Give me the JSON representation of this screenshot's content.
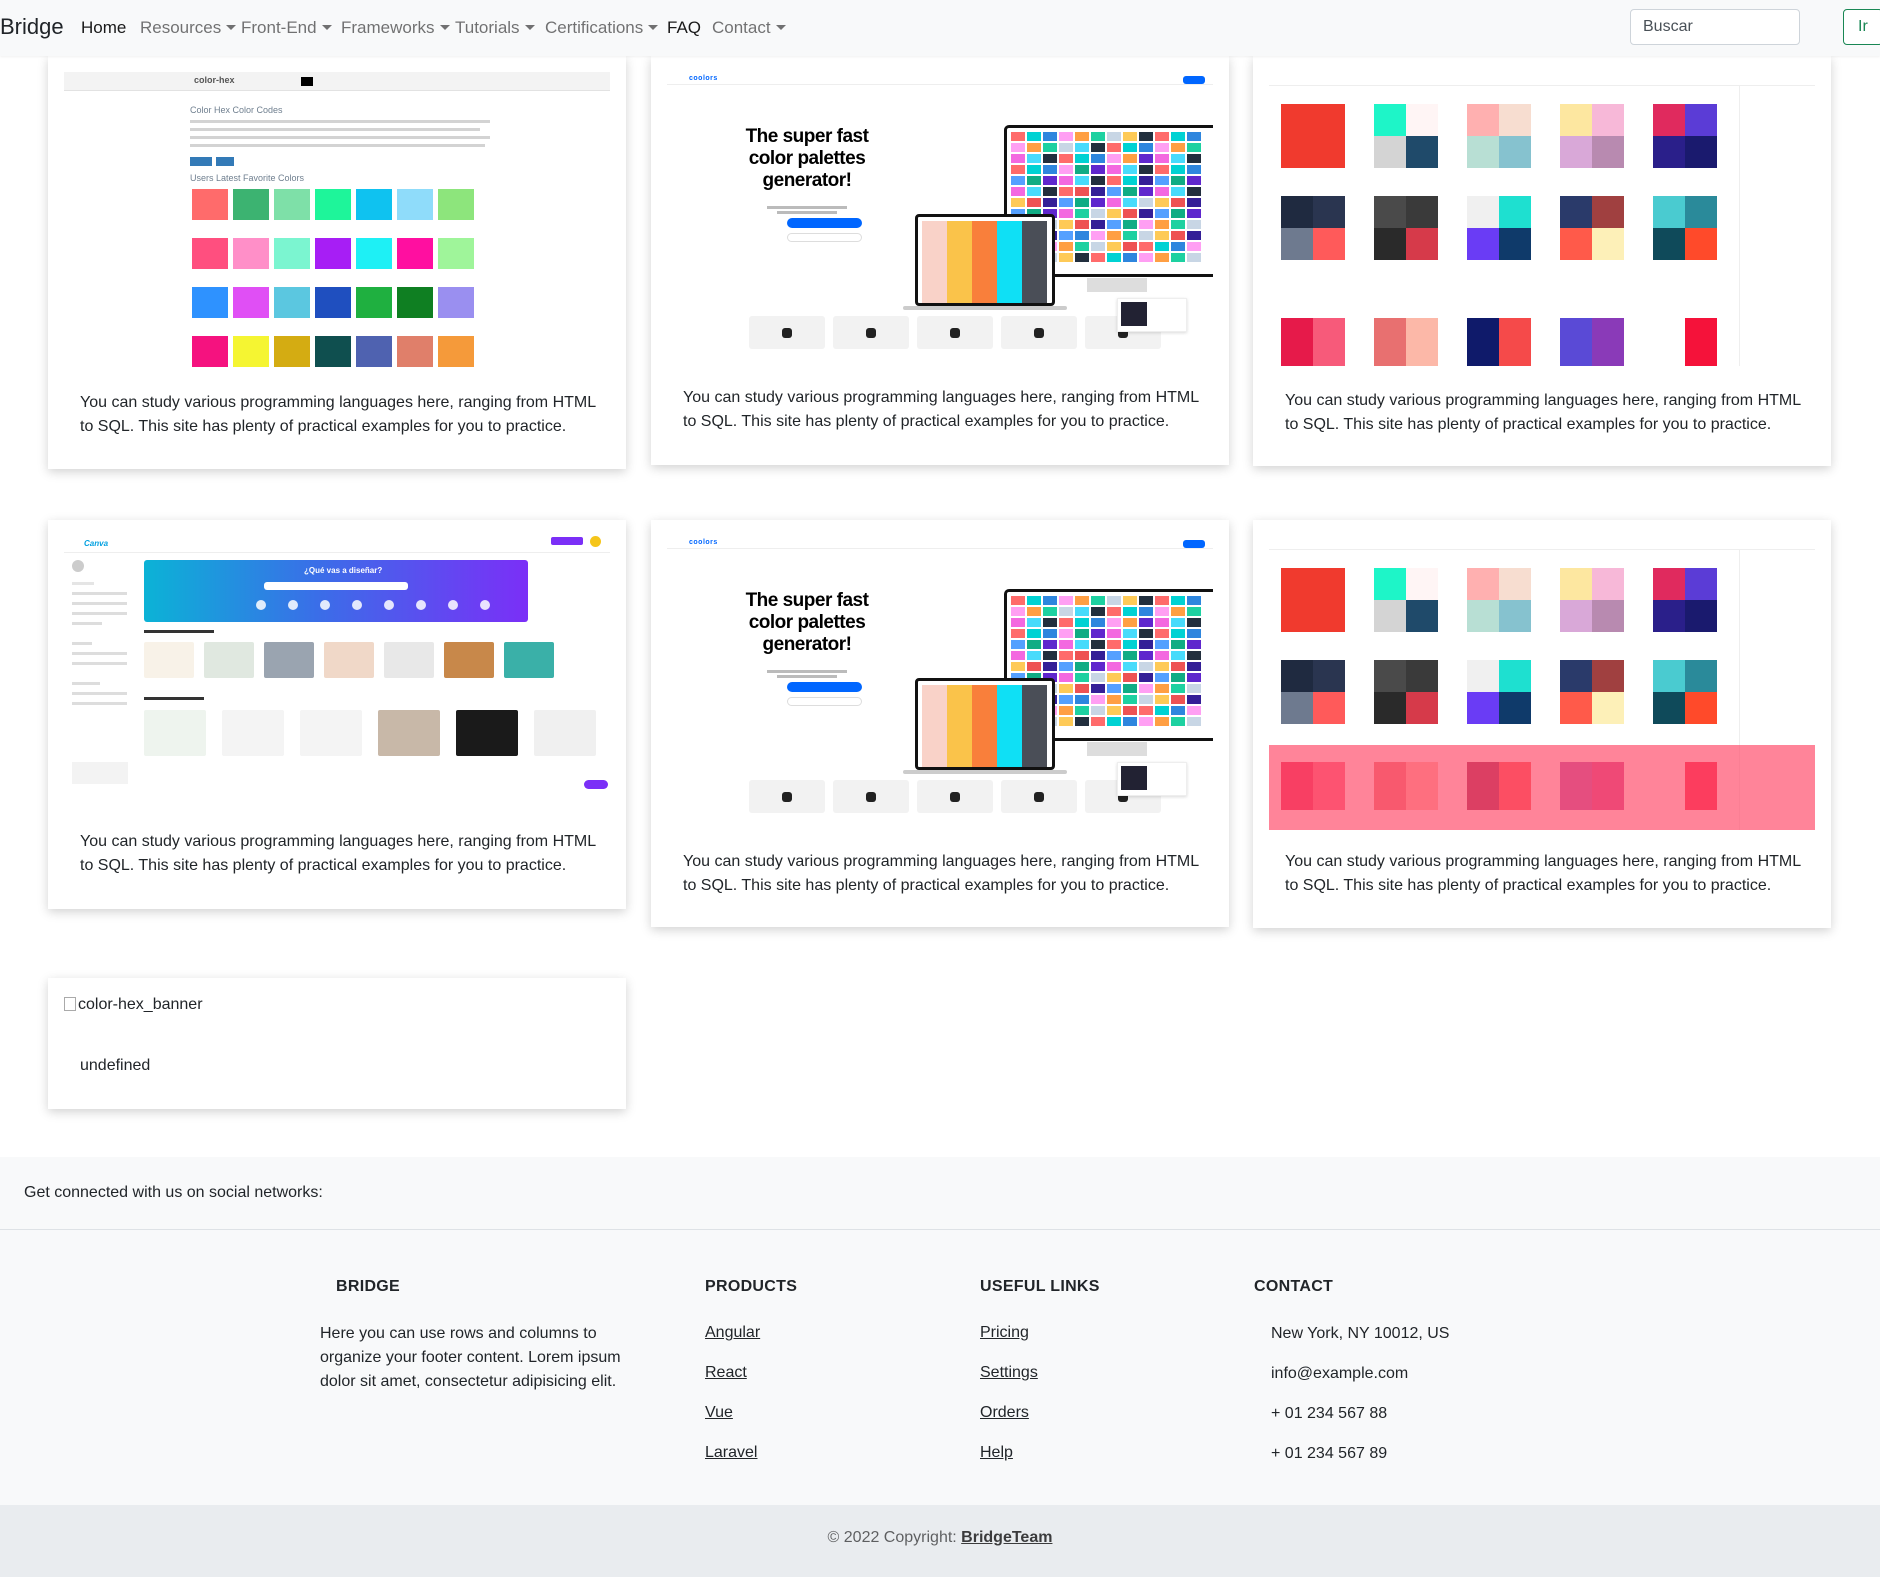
{
  "navbar": {
    "brand": "Bridge",
    "items": [
      {
        "label": "Home",
        "dropdown": false,
        "active": true
      },
      {
        "label": "Resources",
        "dropdown": true
      },
      {
        "label": "Front-End",
        "dropdown": true
      },
      {
        "label": "Frameworks",
        "dropdown": true
      },
      {
        "label": "Tutorials",
        "dropdown": true
      },
      {
        "label": "Certifications",
        "dropdown": true
      },
      {
        "label": "FAQ",
        "dropdown": false
      },
      {
        "label": "Contact",
        "dropdown": true
      }
    ],
    "search_placeholder": "Buscar",
    "search_button": "Ir"
  },
  "cards": [
    {
      "image": "color-hex screenshot",
      "text": "You can study various programming languages here, ranging from HTML to SQL. This site has plenty of practical examples for you to practice."
    },
    {
      "image": "coolors screenshot",
      "text": "You can study various programming languages here, ranging from HTML to SQL. This site has plenty of practical examples for you to practice."
    },
    {
      "image": "colordrop screenshot",
      "text": "You can study various programming languages here, ranging from HTML to SQL. This site has plenty of practical examples for you to practice."
    },
    {
      "image": "canva screenshot",
      "text": "You can study various programming languages here, ranging from HTML to SQL. This site has plenty of practical examples for you to practice."
    },
    {
      "image": "coolors screenshot",
      "text": "You can study various programming languages here, ranging from HTML to SQL. This site has plenty of practical examples for you to practice."
    },
    {
      "image": "colordrop screenshot",
      "text": "You can study various programming languages here, ranging from HTML to SQL. This site has plenty of practical examples for you to practice."
    },
    {
      "image_alt": "color-hex_banner",
      "text": "undefined"
    }
  ],
  "thumbs": {
    "colorhex": {
      "logo": "color-hex",
      "heading": "Color Hex Color Codes",
      "subheading": "Users Latest Favorite Colors"
    },
    "coolors": {
      "logo": "coolors",
      "headline": "The super fast color palettes generator!"
    },
    "canva": {
      "logo": "Canva",
      "question": "¿Qué vas a diseñar?"
    }
  },
  "footer": {
    "social_text": "Get connected with us on social networks:",
    "brand_heading": "BRIDGE",
    "brand_text": "Here you can use rows and columns to organize your footer content. Lorem ipsum dolor sit amet, consectetur adipisicing elit.",
    "products_heading": "PRODUCTS",
    "products": [
      "Angular",
      "React",
      "Vue",
      "Laravel"
    ],
    "links_heading": "USEFUL LINKS",
    "links": [
      "Pricing",
      "Settings",
      "Orders",
      "Help"
    ],
    "contact_heading": "CONTACT",
    "contact": [
      "New York, NY 10012, US",
      "info@example.com",
      "+ 01 234 567 88",
      "+ 01 234 567 89"
    ],
    "copyright_prefix": "© 2022 Copyright: ",
    "copyright_link": "BridgeTeam"
  },
  "colors": {
    "nav_bg": "#f8f9fa",
    "search_button": "#198754",
    "footer_bg": "#f8f9fa",
    "copyright_bg": "#e9ecef",
    "overlay": "#ff6a88"
  }
}
